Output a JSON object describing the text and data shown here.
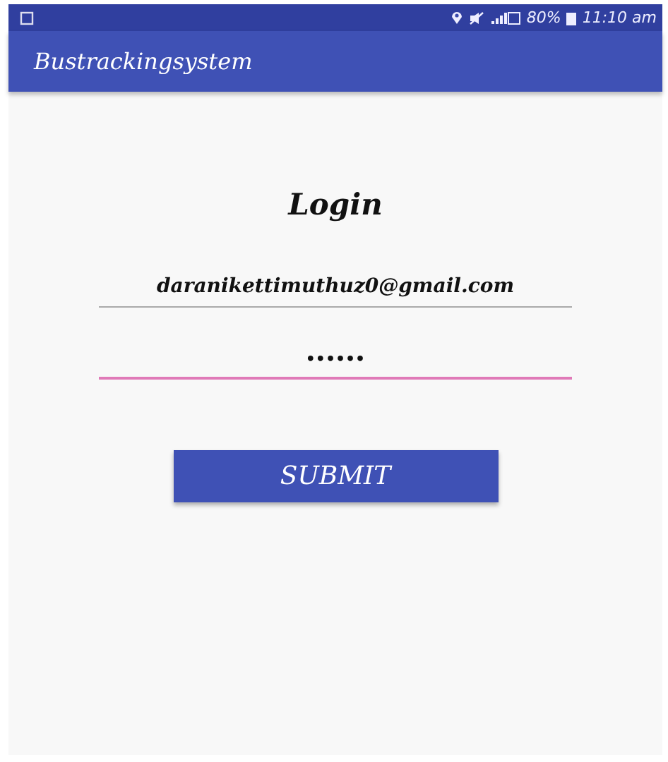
{
  "status_bar": {
    "battery": "80%",
    "time": "11:10 am"
  },
  "app_bar": {
    "title": "Bustrackingsystem"
  },
  "heading": "Login",
  "fields": [
    {
      "kind": "email",
      "value": "daranikettimuthuz0@gmail.com",
      "focused": false
    },
    {
      "kind": "password",
      "value": "••••••",
      "focused": true
    }
  ],
  "submit_button": "SUBMIT"
}
